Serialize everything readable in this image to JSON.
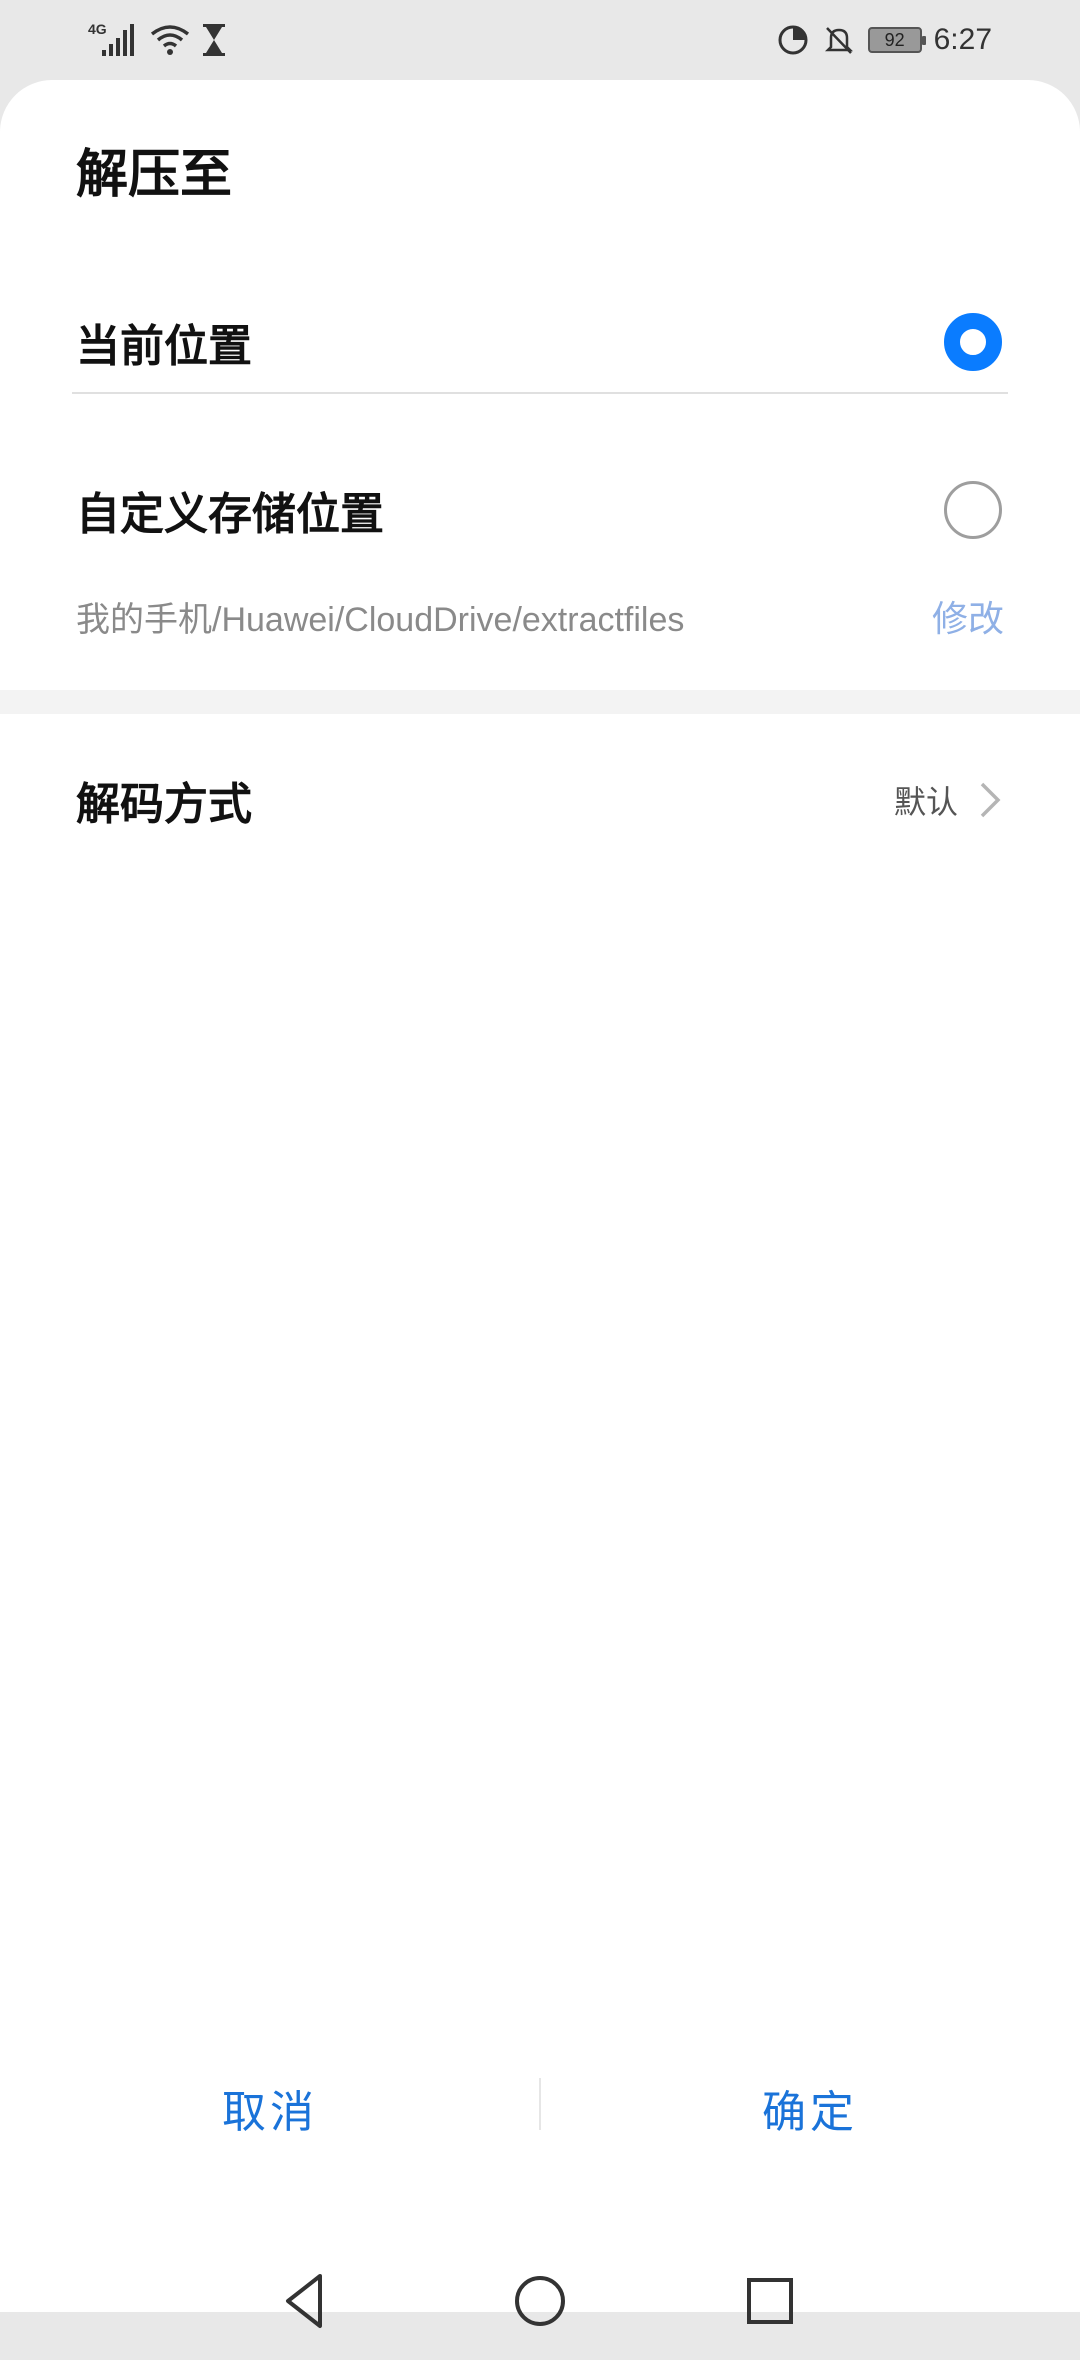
{
  "status_bar": {
    "network": "4G",
    "battery": "92",
    "time": "6:27",
    "icons": [
      "signal-icon",
      "wifi-icon",
      "hourglass-icon",
      "data-saver-icon",
      "bell-off-icon",
      "battery-icon"
    ]
  },
  "dialog": {
    "title": "解压至",
    "options": [
      {
        "label": "当前位置",
        "selected": true
      },
      {
        "label": "自定义存储位置",
        "selected": false
      }
    ],
    "custom_path": "我的手机/Huawei/CloudDrive/extractfiles",
    "modify_label": "修改",
    "decode": {
      "label": "解码方式",
      "value": "默认"
    },
    "cancel_label": "取消",
    "confirm_label": "确定"
  },
  "colors": {
    "accent": "#0a7cff",
    "action_text": "#1a73d9",
    "modify_text": "#8fb0e6"
  },
  "nav_bar": {
    "icons": [
      "back-icon",
      "home-icon",
      "recents-icon"
    ]
  }
}
